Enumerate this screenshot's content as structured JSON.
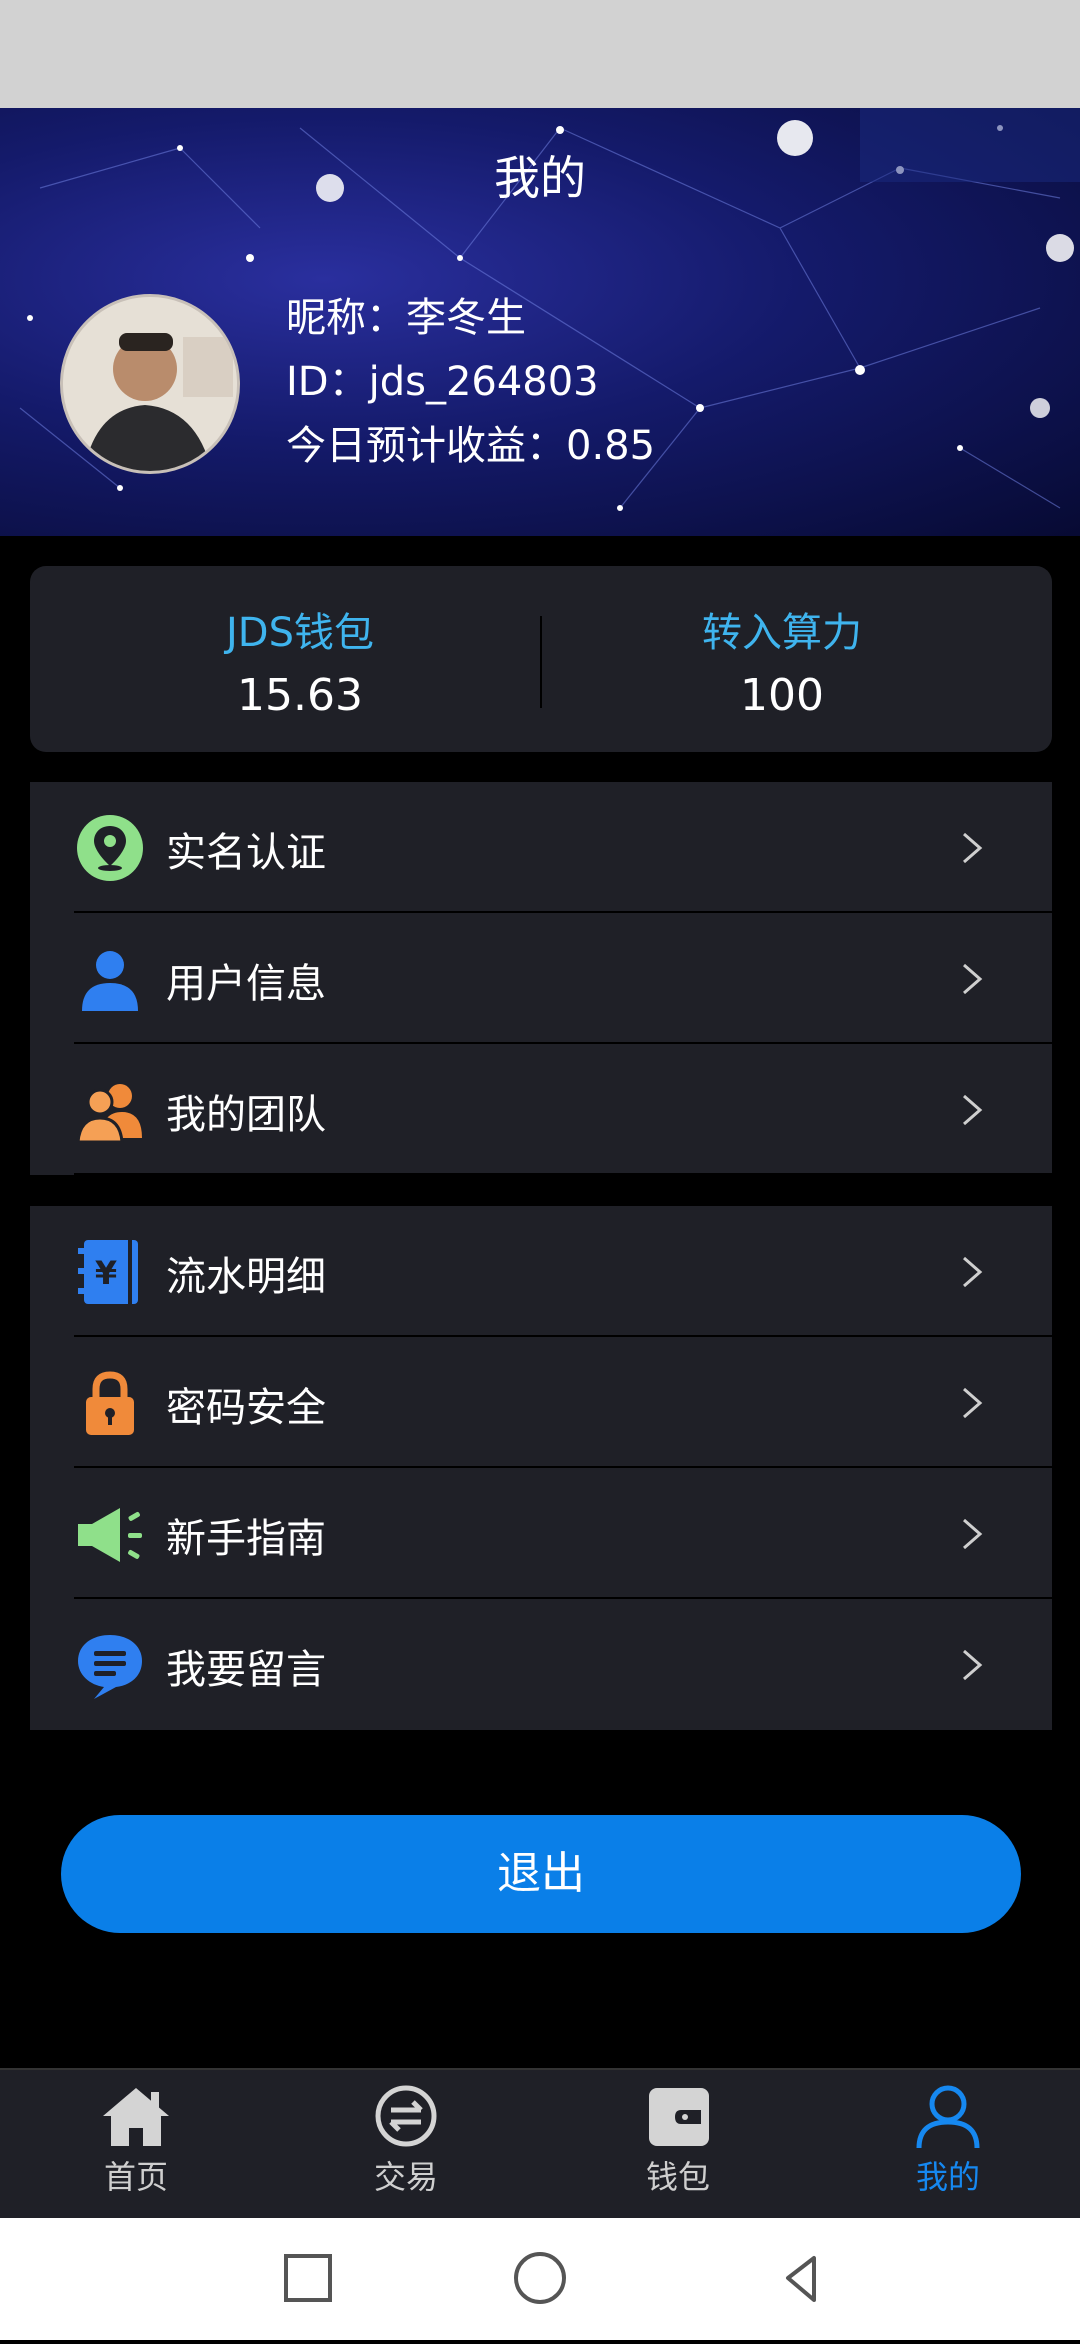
{
  "header": {
    "title": "我的"
  },
  "profile": {
    "nickname_line": "昵称：李冬生",
    "id_line": "ID：jds_264803",
    "earnings_line": "今日预计收益：0.85"
  },
  "wallet_card": {
    "left_label": "JDS钱包",
    "left_value": "15.63",
    "right_label": "转入算力",
    "right_value": "100"
  },
  "menu_group_1": [
    {
      "label": "实名认证",
      "icon": "location-pin-icon"
    },
    {
      "label": "用户信息",
      "icon": "user-icon"
    },
    {
      "label": "我的团队",
      "icon": "team-icon"
    }
  ],
  "menu_group_2": [
    {
      "label": "流水明细",
      "icon": "ledger-yen-icon"
    },
    {
      "label": "密码安全",
      "icon": "lock-icon"
    },
    {
      "label": "新手指南",
      "icon": "megaphone-icon"
    },
    {
      "label": "我要留言",
      "icon": "chat-bubble-icon"
    }
  ],
  "logout": {
    "label": "退出"
  },
  "tabbar": {
    "items": [
      {
        "label": "首页",
        "icon": "home-icon"
      },
      {
        "label": "交易",
        "icon": "exchange-icon"
      },
      {
        "label": "钱包",
        "icon": "wallet-icon"
      },
      {
        "label": "我的",
        "icon": "person-icon"
      }
    ],
    "active_index": 3
  },
  "colors": {
    "accent": "#0a7fe8",
    "card_label": "#3fb4ee",
    "card_bg": "#1f2027",
    "page_bg": "#000000"
  }
}
